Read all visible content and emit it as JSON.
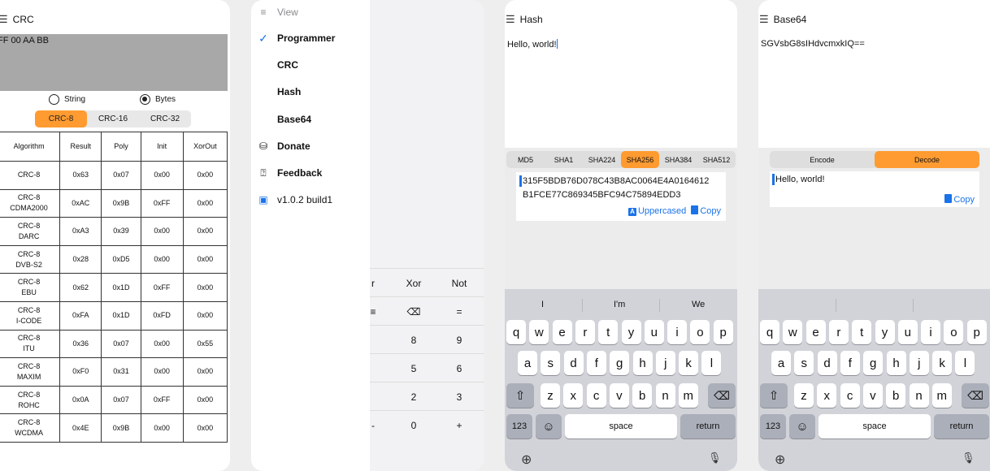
{
  "crc_screen": {
    "title": "CRC",
    "input_value": "FF 00 AA BB",
    "mode_options": [
      {
        "label": "String",
        "selected": false
      },
      {
        "label": "Bytes",
        "selected": true
      }
    ],
    "crc_tabs": [
      {
        "label": "CRC-8",
        "active": true
      },
      {
        "label": "CRC-16",
        "active": false
      },
      {
        "label": "CRC-32",
        "active": false
      }
    ],
    "table": {
      "headers": [
        "Algorithm",
        "Result",
        "Poly",
        "Init",
        "XorOut"
      ],
      "rows": [
        {
          "algo1": "CRC-8",
          "algo2": "",
          "result": "0x63",
          "poly": "0x07",
          "init": "0x00",
          "xorout": "0x00"
        },
        {
          "algo1": "CRC-8",
          "algo2": "CDMA2000",
          "result": "0xAC",
          "poly": "0x9B",
          "init": "0xFF",
          "xorout": "0x00"
        },
        {
          "algo1": "CRC-8",
          "algo2": "DARC",
          "result": "0xA3",
          "poly": "0x39",
          "init": "0x00",
          "xorout": "0x00"
        },
        {
          "algo1": "CRC-8",
          "algo2": "DVB-S2",
          "result": "0x28",
          "poly": "0xD5",
          "init": "0x00",
          "xorout": "0x00"
        },
        {
          "algo1": "CRC-8",
          "algo2": "EBU",
          "result": "0x62",
          "poly": "0x1D",
          "init": "0xFF",
          "xorout": "0x00"
        },
        {
          "algo1": "CRC-8",
          "algo2": "I-CODE",
          "result": "0xFA",
          "poly": "0x1D",
          "init": "0xFD",
          "xorout": "0x00"
        },
        {
          "algo1": "CRC-8",
          "algo2": "ITU",
          "result": "0x36",
          "poly": "0x07",
          "init": "0x00",
          "xorout": "0x55"
        },
        {
          "algo1": "CRC-8",
          "algo2": "MAXIM",
          "result": "0xF0",
          "poly": "0x31",
          "init": "0x00",
          "xorout": "0x00"
        },
        {
          "algo1": "CRC-8",
          "algo2": "ROHC",
          "result": "0x0A",
          "poly": "0x07",
          "init": "0xFF",
          "xorout": "0x00"
        },
        {
          "algo1": "CRC-8",
          "algo2": "WCDMA",
          "result": "0x4E",
          "poly": "0x9B",
          "init": "0x00",
          "xorout": "0x00"
        }
      ]
    }
  },
  "menu_screen": {
    "header": "View",
    "items": [
      {
        "label": "Programmer",
        "icon": "checkmark-icon",
        "glyph": "✓"
      },
      {
        "label": "CRC",
        "icon": "",
        "glyph": ""
      },
      {
        "label": "Hash",
        "icon": "",
        "glyph": ""
      },
      {
        "label": "Base64",
        "icon": "",
        "glyph": ""
      },
      {
        "label": "Donate",
        "icon": "coins-icon",
        "glyph": "⛁"
      },
      {
        "label": "Feedback",
        "icon": "feedback-icon",
        "glyph": "⍰"
      },
      {
        "label": "v1.0.2 build1",
        "icon": "app-icon",
        "glyph": "▣"
      }
    ],
    "calculator": {
      "row1": [
        "r",
        "Xor",
        "Not"
      ],
      "row2": [
        "≡",
        "⌫",
        "="
      ],
      "row3": [
        "",
        "8",
        "9"
      ],
      "row4": [
        "",
        "5",
        "6"
      ],
      "row5": [
        "",
        "2",
        "3"
      ],
      "row6": [
        "-",
        "0",
        "+"
      ]
    }
  },
  "hash_screen": {
    "title": "Hash",
    "input_value": "Hello, world!",
    "algorithms": [
      {
        "label": "MD5",
        "active": false
      },
      {
        "label": "SHA1",
        "active": false
      },
      {
        "label": "SHA224",
        "active": false
      },
      {
        "label": "SHA256",
        "active": true
      },
      {
        "label": "SHA384",
        "active": false
      },
      {
        "label": "SHA512",
        "active": false
      }
    ],
    "output_line1": "315F5BDB76D078C43B8AC0064E4A0164612",
    "output_line2": "B1FCE77C869345BFC94C75894EDD3",
    "uppercased_label": "Uppercased",
    "copy_label": "Copy",
    "suggestions": [
      "I",
      "I'm",
      "We"
    ]
  },
  "base64_screen": {
    "title": "Base64",
    "input_value": "SGVsbG8sIHdvcmxkIQ==",
    "modes": [
      {
        "label": "Encode",
        "active": false
      },
      {
        "label": "Decode",
        "active": true
      }
    ],
    "output_value": "Hello, world!",
    "copy_label": "Copy"
  },
  "keyboard": {
    "row1": [
      "q",
      "w",
      "e",
      "r",
      "t",
      "y",
      "u",
      "i",
      "o",
      "p"
    ],
    "row2": [
      "a",
      "s",
      "d",
      "f",
      "g",
      "h",
      "j",
      "k",
      "l"
    ],
    "row3": [
      "z",
      "x",
      "c",
      "v",
      "b",
      "n",
      "m"
    ],
    "numbers_label": "123",
    "space_label": "space",
    "return_label": "return"
  },
  "colors": {
    "accent": "#ff9b30",
    "link": "#1a73e8",
    "input_grey": "#a8a8a8",
    "keyboard_bg": "#d1d3d9"
  }
}
